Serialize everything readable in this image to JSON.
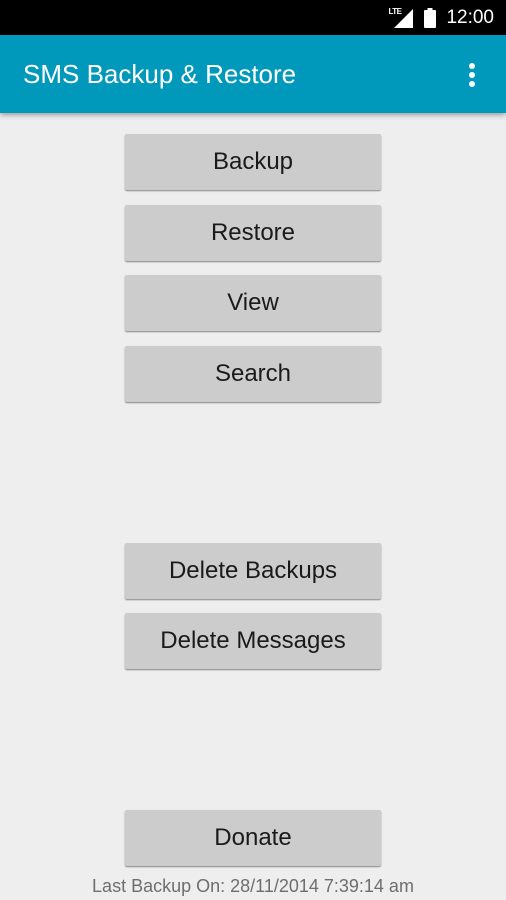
{
  "status_bar": {
    "network_label": "LTE",
    "time": "12:00",
    "icons": [
      "lte-signal-icon",
      "battery-icon"
    ]
  },
  "app_bar": {
    "title": "SMS Backup & Restore",
    "menu_icon": "overflow-menu-icon"
  },
  "colors": {
    "app_bar": "#0099bc",
    "status_bar": "#000000",
    "background": "#eeeeee",
    "button": "#cccccc"
  },
  "buttons": {
    "backup": "Backup",
    "restore": "Restore",
    "view": "View",
    "search": "Search",
    "delete_backups": "Delete Backups",
    "delete_messages": "Delete Messages",
    "donate": "Donate"
  },
  "footer": {
    "last_backup": "Last Backup On: 28/11/2014 7:39:14 am"
  }
}
